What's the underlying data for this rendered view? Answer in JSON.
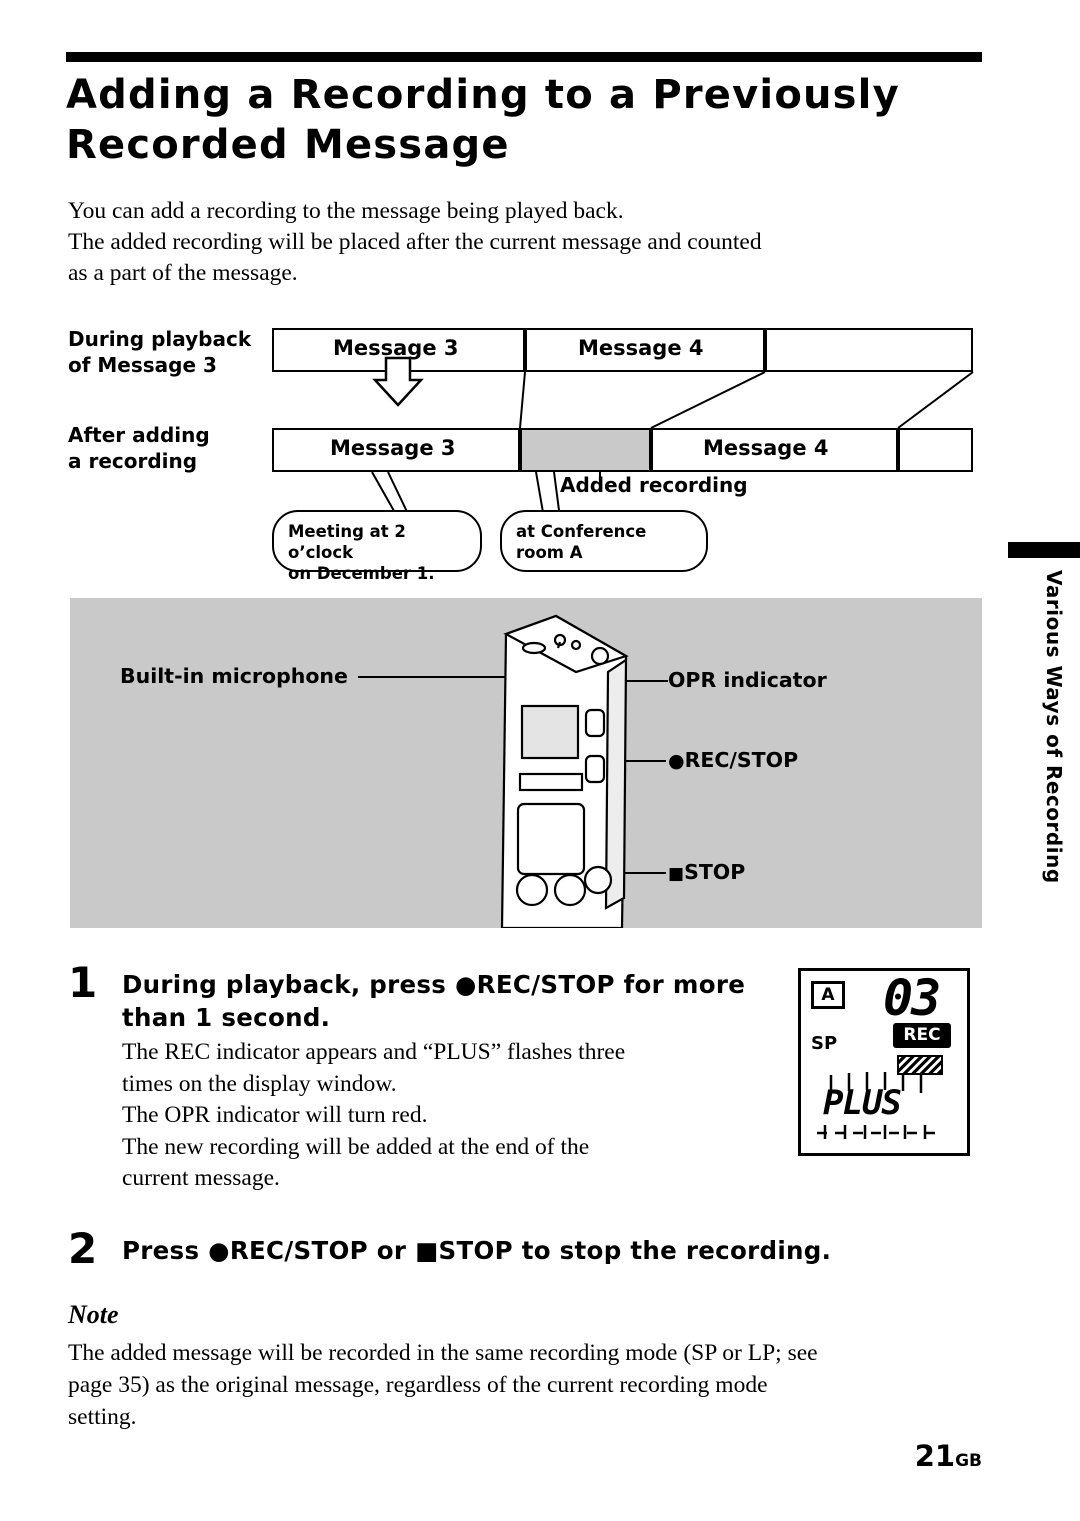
{
  "title": "Adding a Recording to a Previously Recorded Message",
  "intro": {
    "line1": "You can add a recording to the message being played back.",
    "line2": "The added recording will be placed after the current message and counted",
    "line3": "as a part of the message."
  },
  "diagram": {
    "label_before_line1": "During playback",
    "label_before_line2": "of Message 3",
    "label_after_line1": "After adding",
    "label_after_line2": "a recording",
    "row_before": [
      "Message 3",
      "Message 4"
    ],
    "row_after": [
      "Message 3",
      "Message 4"
    ],
    "added_recording_label": "Added recording",
    "callout_left_line1": "Meeting at 2 o’clock",
    "callout_left_line2": "on December 1.",
    "callout_right_line1": "at Conference",
    "callout_right_line2": "room A"
  },
  "photo": {
    "mic_label": "Built-in microphone",
    "opr_label": "OPR indicator",
    "rec_stop_label": "REC/STOP",
    "stop_label": "STOP"
  },
  "steps": [
    {
      "num": "1",
      "head_line1": "During playback, press  ●REC/STOP for more",
      "head_line2": "than 1 second.",
      "body": [
        "The REC indicator appears and “PLUS” flashes three",
        "times on the display window.",
        "The OPR indicator will turn red.",
        "The new recording will be added at the end of the",
        "current message."
      ]
    },
    {
      "num": "2",
      "head_line1": "Press  ●REC/STOP or  ■STOP to stop the recording.",
      "head_line2": "",
      "body": []
    }
  ],
  "lcd": {
    "channel": "A",
    "number": "03",
    "rec": "REC",
    "mode": "SP",
    "plus": "PLUS"
  },
  "note": {
    "heading": "Note",
    "line1": "The added message will be recorded in the same recording mode (SP or LP; see",
    "line2": "page 35) as the original message, regardless of the current recording mode",
    "line3": "setting."
  },
  "side_tab": "Various Ways of Recording",
  "page_number": "21",
  "page_number_suffix": "GB"
}
